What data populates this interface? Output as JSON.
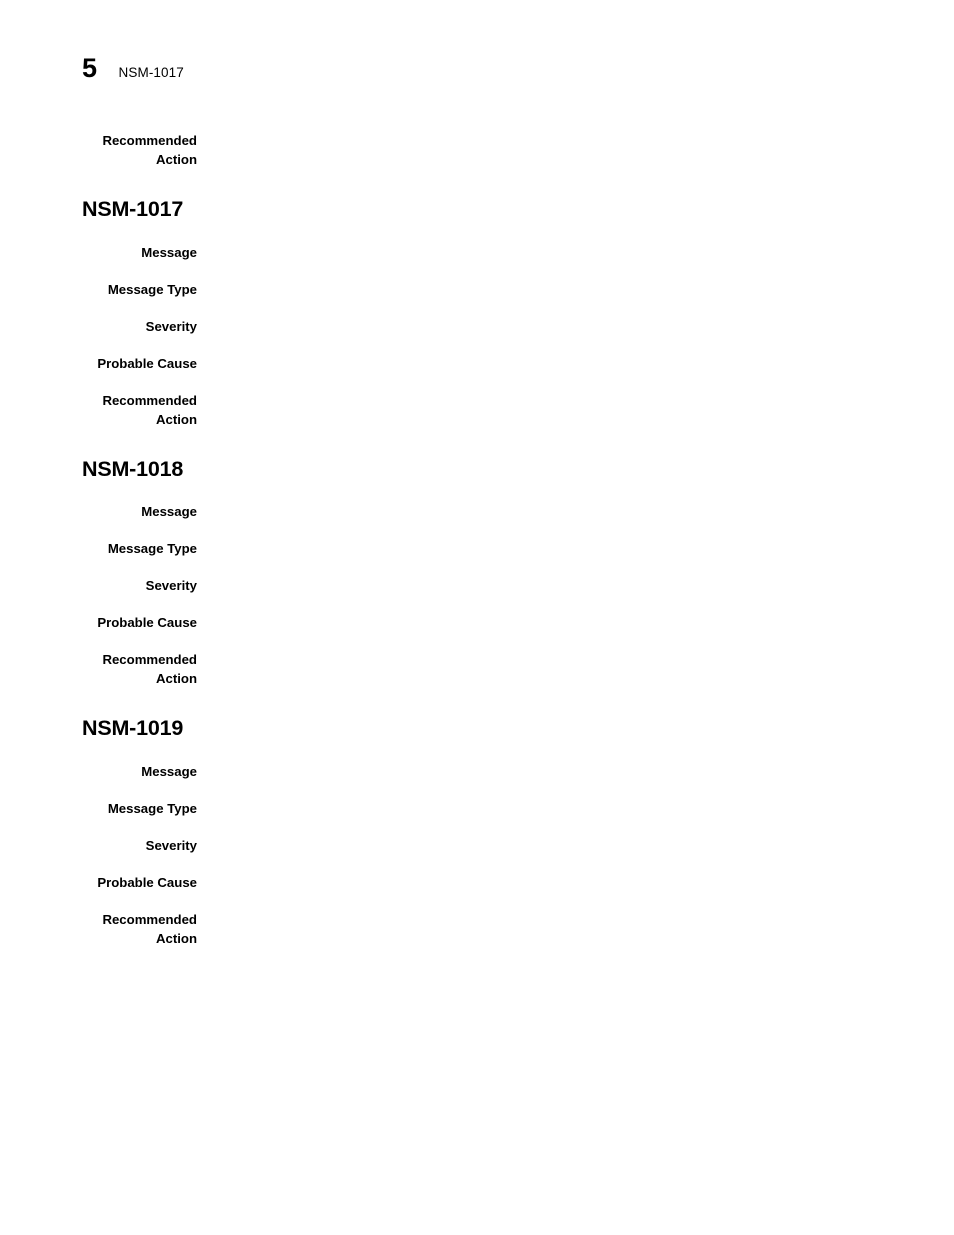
{
  "header": {
    "page_number": "5",
    "chapter_label": "NSM-1017"
  },
  "leading_fields": [
    {
      "label": "Recommended\nAction",
      "value": ""
    }
  ],
  "field_labels": {
    "message": "Message",
    "message_type": "Message Type",
    "severity": "Severity",
    "probable_cause": "Probable Cause",
    "recommended_action": "Recommended\nAction"
  },
  "sections": [
    {
      "heading": "NSM-1017",
      "fields": [
        {
          "label": "Message",
          "value": ""
        },
        {
          "label": "Message Type",
          "value": ""
        },
        {
          "label": "Severity",
          "value": ""
        },
        {
          "label": "Probable Cause",
          "value": ""
        },
        {
          "label": "Recommended\nAction",
          "value": ""
        }
      ]
    },
    {
      "heading": "NSM-1018",
      "fields": [
        {
          "label": "Message",
          "value": ""
        },
        {
          "label": "Message Type",
          "value": ""
        },
        {
          "label": "Severity",
          "value": ""
        },
        {
          "label": "Probable Cause",
          "value": ""
        },
        {
          "label": "Recommended\nAction",
          "value": ""
        }
      ]
    },
    {
      "heading": "NSM-1019",
      "fields": [
        {
          "label": "Message",
          "value": ""
        },
        {
          "label": "Message Type",
          "value": ""
        },
        {
          "label": "Severity",
          "value": ""
        },
        {
          "label": "Probable Cause",
          "value": ""
        },
        {
          "label": "Recommended\nAction",
          "value": ""
        }
      ]
    }
  ],
  "colors": {
    "page_background": "#ffffff",
    "text": "#000000"
  }
}
